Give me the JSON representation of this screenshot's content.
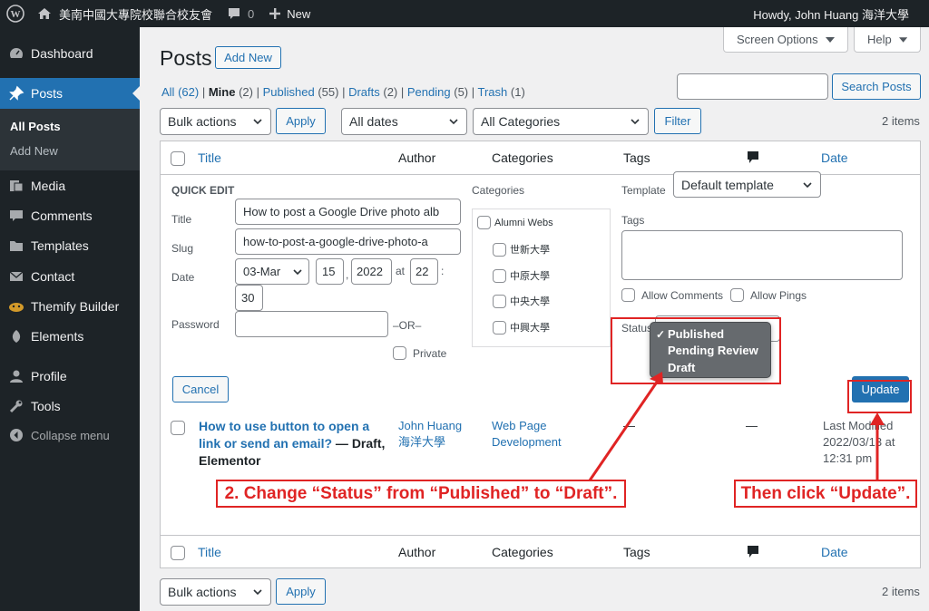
{
  "adminbar": {
    "site_name": "美南中國大專院校聯合校友會",
    "comments_count": "0",
    "new_label": "New",
    "howdy": "Howdy, John Huang 海洋大學"
  },
  "sidebar": {
    "items": [
      {
        "label": "Dashboard",
        "icon": "dashboard-icon"
      },
      {
        "label": "Posts",
        "icon": "pin-icon"
      },
      {
        "label": "Media",
        "icon": "media-icon"
      },
      {
        "label": "Comments",
        "icon": "comments-icon"
      },
      {
        "label": "Templates",
        "icon": "folder-icon"
      },
      {
        "label": "Contact",
        "icon": "mail-icon"
      },
      {
        "label": "Themify Builder",
        "icon": "themify-icon"
      },
      {
        "label": "Elements",
        "icon": "elements-icon"
      },
      {
        "label": "Profile",
        "icon": "user-icon"
      },
      {
        "label": "Tools",
        "icon": "wrench-icon"
      },
      {
        "label": "Collapse menu",
        "icon": "collapse-icon"
      }
    ],
    "submenu": [
      "All Posts",
      "Add New"
    ]
  },
  "header": {
    "screen_options": "Screen Options",
    "help": "Help",
    "title": "Posts",
    "add_new": "Add New"
  },
  "filters": {
    "views": [
      {
        "label": "All",
        "count": "(62)"
      },
      {
        "label": "Mine",
        "count": "(2)"
      },
      {
        "label": "Published",
        "count": "(55)"
      },
      {
        "label": "Drafts",
        "count": "(2)"
      },
      {
        "label": "Pending",
        "count": "(5)"
      },
      {
        "label": "Trash",
        "count": "(1)"
      }
    ],
    "search_button": "Search Posts",
    "bulk_actions": "Bulk actions",
    "apply": "Apply",
    "all_dates": "All dates",
    "all_categories": "All Categories",
    "filter": "Filter",
    "items_count": "2 items"
  },
  "table": {
    "columns": {
      "title": "Title",
      "author": "Author",
      "categories": "Categories",
      "tags": "Tags",
      "date": "Date"
    }
  },
  "quick_edit": {
    "heading": "QUICK EDIT",
    "title_label": "Title",
    "title_value": "How to post a Google Drive photo alb",
    "slug_label": "Slug",
    "slug_value": "how-to-post-a-google-drive-photo-a",
    "date_label": "Date",
    "month": "03-Mar",
    "day": "15",
    "year": "2022",
    "at": "at",
    "hour": "22",
    "minute": "30",
    "password_label": "Password",
    "or": "–OR–",
    "private": "Private",
    "categories_label": "Categories",
    "categories": [
      "Alumni Webs",
      "世新大學",
      "中原大學",
      "中央大學",
      "中興大學"
    ],
    "template_label": "Template",
    "template_value": "Default template",
    "tags_label": "Tags",
    "allow_comments": "Allow Comments",
    "allow_pings": "Allow Pings",
    "status_label": "Status",
    "status_options": [
      "Published",
      "Pending Review",
      "Draft"
    ],
    "checkmark": "✓",
    "cancel": "Cancel",
    "update": "Update"
  },
  "row": {
    "title": "How to use button to open a link or send an email?",
    "title_line1": "How to use button to open a",
    "title_line2": "link or send an email?",
    "state": " — Draft,",
    "state2": "Elementor",
    "author_line1": "John Huang",
    "author_line2": "海洋大學",
    "category_line1": "Web Page",
    "category_line2": "Development",
    "tags": "—",
    "comments": "—",
    "date_line1": "Last Modified",
    "date_line2": "2022/03/13 at",
    "date_line3": "12:31 pm"
  },
  "annotations": {
    "step2": "2. Change “Status” from “Published” to “Draft”.",
    "step3": "Then click “Update”."
  },
  "colors": {
    "accent": "#2271b1",
    "annotation": "#e02424",
    "adminbar": "#1d2327"
  }
}
